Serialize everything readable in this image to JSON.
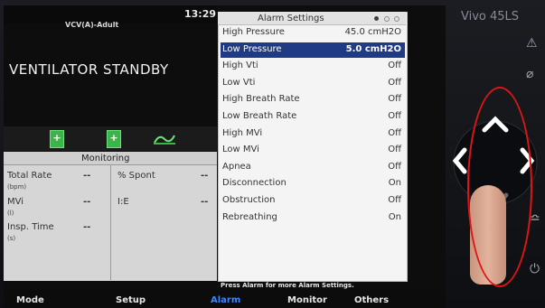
{
  "status": {
    "clock": "13:29",
    "ventilation_mode": "VCV(A)-Adult",
    "standby_text": "VENTILATOR STANDBY"
  },
  "monitoring": {
    "title": "Monitoring",
    "items": [
      {
        "label": "Total Rate",
        "unit": "(bpm)",
        "value": "--"
      },
      {
        "label": "% Spont",
        "unit": "",
        "value": "--"
      },
      {
        "label": "MVi",
        "unit": "(l)",
        "value": "--"
      },
      {
        "label": "I:E",
        "unit": "",
        "value": "--"
      },
      {
        "label": "Insp. Time",
        "unit": "(s)",
        "value": "--"
      }
    ]
  },
  "alarm_settings": {
    "title": "Alarm Settings",
    "selected_index": 1,
    "rows": [
      {
        "name": "High Pressure",
        "value": "45.0 cmH2O"
      },
      {
        "name": "Low Pressure",
        "value": "5.0 cmH2O"
      },
      {
        "name": "High Vti",
        "value": "Off"
      },
      {
        "name": "Low Vti",
        "value": "Off"
      },
      {
        "name": "High Breath Rate",
        "value": "Off"
      },
      {
        "name": "Low Breath Rate",
        "value": "Off"
      },
      {
        "name": "High MVi",
        "value": "Off"
      },
      {
        "name": "Low MVi",
        "value": "Off"
      },
      {
        "name": "Apnea",
        "value": "Off"
      },
      {
        "name": "Disconnection",
        "value": "On"
      },
      {
        "name": "Obstruction",
        "value": "Off"
      },
      {
        "name": "Rebreathing",
        "value": "On"
      }
    ],
    "hint": "Press Alarm for more Alarm Settings."
  },
  "tabs": [
    {
      "label": "Mode",
      "active": false
    },
    {
      "label": "Setup",
      "active": false
    },
    {
      "label": "Alarm",
      "active": true
    },
    {
      "label": "Monitor",
      "active": false
    },
    {
      "label": "Others",
      "active": false
    }
  ],
  "device": {
    "brand": "Vivo 45LS"
  },
  "colors": {
    "selection": "#1f3b86",
    "active_tab": "#3d86ff",
    "green_icon": "#3bb54a",
    "annotation_ring": "#e01515"
  },
  "icons": [
    "plus-icon",
    "left-plus-icon",
    "wave-icon",
    "warning-icon",
    "alarm-mute-icon",
    "up-arrow-icon",
    "left-arrow-icon",
    "right-arrow-icon",
    "down-arrow-icon",
    "settings-side-icon",
    "power-icon"
  ]
}
